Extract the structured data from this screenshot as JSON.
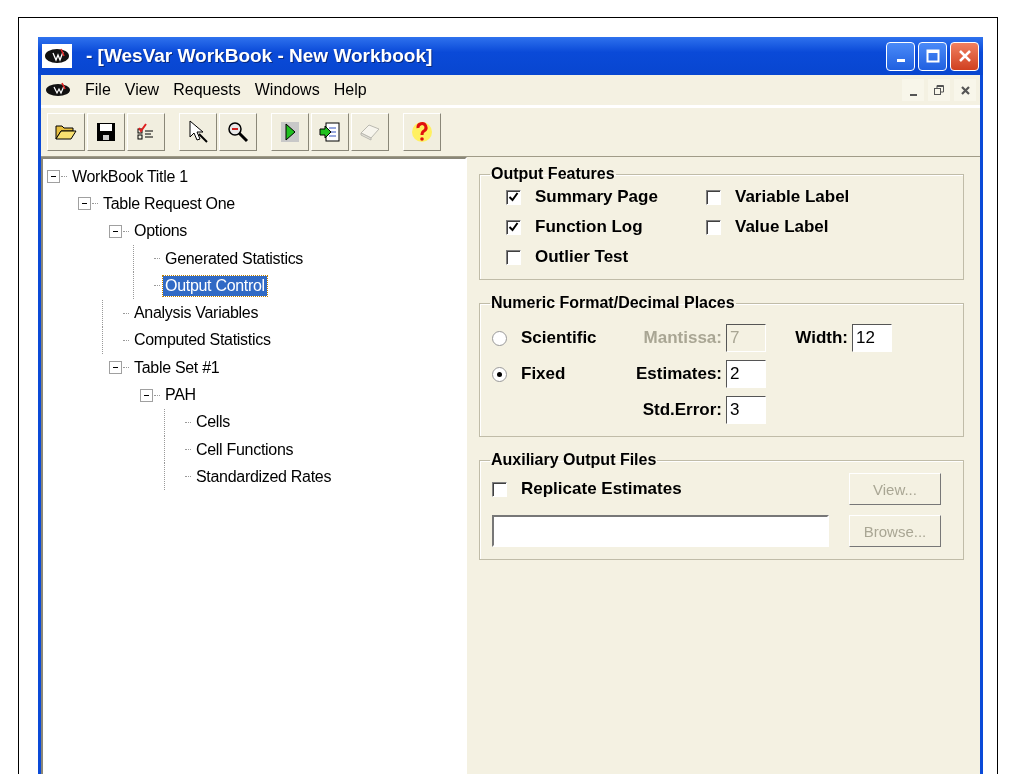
{
  "window": {
    "title": "- [WesVar WorkBook - New Workbook]"
  },
  "menu": [
    {
      "label": "File"
    },
    {
      "label": "View"
    },
    {
      "label": "Requests"
    },
    {
      "label": "Windows"
    },
    {
      "label": "Help"
    }
  ],
  "toolbar": [
    [
      {
        "kind": "open",
        "disabled": false
      },
      {
        "kind": "save",
        "disabled": false
      },
      {
        "kind": "checklist",
        "disabled": false
      }
    ],
    [
      {
        "kind": "pointer",
        "disabled": false
      },
      {
        "kind": "zoom",
        "disabled": false
      }
    ],
    [
      {
        "kind": "run",
        "disabled": false
      },
      {
        "kind": "export",
        "disabled": false
      },
      {
        "kind": "book",
        "disabled": true
      }
    ],
    [
      {
        "kind": "help",
        "disabled": false
      }
    ]
  ],
  "tree": [
    {
      "label": "WorkBook Title 1",
      "selected": false,
      "expanded": true,
      "children": [
        {
          "label": "Table Request One",
          "selected": false,
          "expanded": true,
          "children": [
            {
              "label": "Options",
              "selected": false,
              "expanded": true,
              "children": [
                {
                  "label": "Generated Statistics",
                  "selected": false
                },
                {
                  "label": "Output Control",
                  "selected": true
                }
              ]
            },
            {
              "label": "Analysis Variables",
              "selected": false
            },
            {
              "label": "Computed Statistics",
              "selected": false
            },
            {
              "label": "Table Set #1",
              "selected": false,
              "expanded": true,
              "children": [
                {
                  "label": "PAH",
                  "selected": false,
                  "expanded": true,
                  "children": [
                    {
                      "label": "Cells",
                      "selected": false
                    },
                    {
                      "label": "Cell Functions",
                      "selected": false
                    },
                    {
                      "label": "Standardized Rates",
                      "selected": false
                    }
                  ]
                }
              ]
            }
          ]
        }
      ]
    }
  ],
  "output_features": {
    "title": "Output Features",
    "options": [
      {
        "label": "Summary Page",
        "checked": true
      },
      {
        "label": "Function Log",
        "checked": true
      },
      {
        "label": "Outlier Test",
        "checked": false
      },
      {
        "label": "Variable Label",
        "checked": false
      },
      {
        "label": "Value Label",
        "checked": false
      }
    ]
  },
  "numeric_format": {
    "title": "Numeric Format/Decimal Places",
    "modes": [
      {
        "label": "Scientific",
        "selected": false
      },
      {
        "label": "Fixed",
        "selected": true
      }
    ],
    "fields": [
      {
        "label": "Mantissa:",
        "value": "7",
        "disabled": true
      },
      {
        "label": "Width:",
        "value": "12",
        "disabled": false
      },
      {
        "label": "Estimates:",
        "value": "2",
        "disabled": false
      },
      {
        "label": "Std.Error:",
        "value": "3",
        "disabled": false
      }
    ]
  },
  "auxiliary": {
    "title": "Auxiliary Output Files",
    "option": {
      "label": "Replicate Estimates",
      "checked": false
    },
    "buttons": [
      {
        "label": "View...",
        "disabled": true
      },
      {
        "label": "Browse...",
        "disabled": true
      }
    ]
  }
}
